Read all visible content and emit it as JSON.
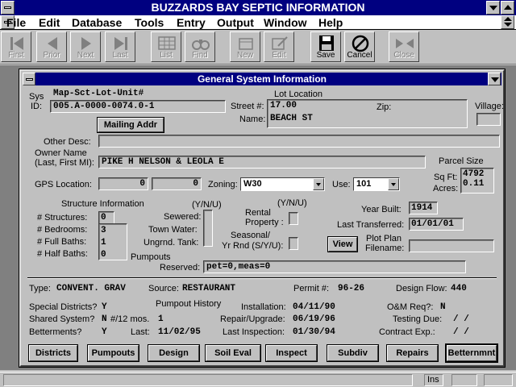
{
  "app": {
    "title": "BUZZARDS BAY SEPTIC INFORMATION"
  },
  "menu": [
    "File",
    "Edit",
    "Database",
    "Tools",
    "Entry",
    "Output",
    "Window",
    "Help"
  ],
  "toolbar": {
    "first": "First",
    "prior": "Prior",
    "next": "Next",
    "last": "Last",
    "list": "List",
    "find": "Find",
    "new": "New",
    "edit": "Edit",
    "save": "Save",
    "cancel": "Cancel",
    "close": "Close"
  },
  "window": {
    "title": "General System Information"
  },
  "form": {
    "sys_label": "Sys",
    "id_label": "ID:",
    "map_header": "Map-Sct-Lot-Unit#",
    "sys_id": "005.A-0000-0074.0-1",
    "mailing_addr_button": "Mailing Addr",
    "lot_location_label": "Lot Location",
    "street_label": "Street #:",
    "street_number": "17.00",
    "zip_label": "Zip:",
    "zip": "",
    "name_label": "Name:",
    "street_name": "BEACH ST",
    "village_label": "Village:",
    "village": "",
    "other_desc_label": "Other Desc:",
    "other_desc": "",
    "owner_label_1": "Owner Name",
    "owner_label_2": "(Last, First MI):",
    "owner_name": "PIKE H NELSON & LEOLA E",
    "parcel_size_label": "Parcel Size",
    "sqft_label": "Sq Ft:",
    "sqft": "4792",
    "acres_label": "Acres:",
    "acres": "0.11",
    "gps_label": "GPS Location:",
    "gps_1": "0",
    "gps_2": "0",
    "zoning_label": "Zoning:",
    "zoning": "W30",
    "use_label": "Use:",
    "use": "101",
    "structure_info_label": "Structure Information",
    "structures_label": "# Structures:",
    "structures": "0",
    "bedrooms_label": "# Bedrooms:",
    "bedrooms": "3",
    "full_baths_label": "# Full Baths:",
    "full_baths": "1",
    "half_baths_label": "# Half Baths:",
    "half_baths": "0",
    "yn_label_1": "(Y/N/U)",
    "sewered_label": "Sewered:",
    "town_water_label": "Town Water:",
    "ungrnd_tank_label": "Ungrnd. Tank:",
    "yn_label_2": "(Y/N/U)",
    "rental_label_1": "Rental",
    "rental_label_2": "Property :",
    "seasonal_label_1": "Seasonal/",
    "seasonal_label_2": "Yr Rnd (S/Y/U):",
    "pumpouts_label": "Pumpouts",
    "year_built_label": "Year Built:",
    "year_built": "1914",
    "last_transferred_label": "Last Transferred:",
    "last_transferred": "01/01/01",
    "view_button": "View",
    "plot_plan_label_1": "Plot Plan",
    "plot_plan_label_2": "Filename:",
    "plot_plan": "",
    "reserved_label": "Reserved:",
    "reserved": "pet=0,meas=0"
  },
  "system": {
    "type_label": "Type:",
    "type": "CONVENT. GRAV",
    "source_label": "Source:",
    "source": "RESTAURANT",
    "permit_label": "Permit #:",
    "permit": "96-26",
    "design_flow_label": "Design Flow:",
    "design_flow": "440",
    "special_label": "Special Districts?",
    "special": "Y",
    "pumpout_history_label": "Pumpout History",
    "installation_label": "Installation:",
    "installation": "04/11/90",
    "om_label": "O&M Req?:",
    "om": "N",
    "shared_label": "Shared System?",
    "shared": "N",
    "per12_label": "#/12 mos.",
    "per12": "1",
    "repair_label": "Repair/Upgrade:",
    "repair": "06/19/96",
    "testing_label": "Testing Due:",
    "testing": "/  /",
    "betterments_label": "Betterments?",
    "betterments": "Y",
    "last_label": "Last:",
    "last": "11/02/95",
    "last_inspection_label": "Last Inspection:",
    "last_inspection": "01/30/94",
    "contract_label": "Contract Exp.:",
    "contract": "/  /"
  },
  "buttons": [
    "Districts",
    "Pumpouts",
    "Design",
    "Soil Eval",
    "Inspect",
    "Subdiv",
    "Repairs",
    "Betternmnt"
  ],
  "status": {
    "ins": "Ins"
  }
}
